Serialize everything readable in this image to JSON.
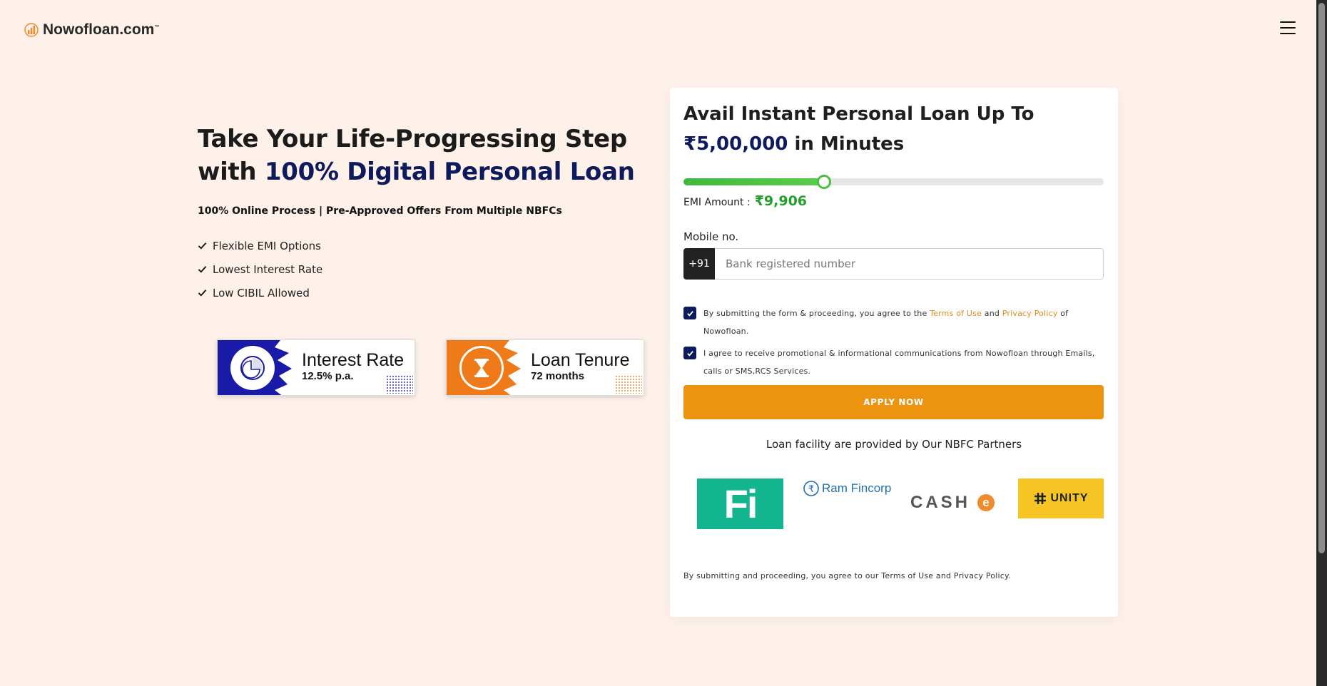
{
  "header": {
    "logo_text": "Nowofloan.com",
    "logo_tm": "™"
  },
  "hero": {
    "title_part1": "Take Your Life-Progressing Step with ",
    "title_highlight": "100% Digital Personal Loan",
    "subtitle": "100% Online Process | Pre-Approved Offers From Multiple NBFCs",
    "features": [
      "Flexible EMI Options",
      "Lowest Interest Rate",
      "Low CIBIL Allowed"
    ]
  },
  "badges": [
    {
      "title": "Interest Rate",
      "value": "12.5% p.a.",
      "color": "#1a1aa8",
      "icon": "pie-chart-icon"
    },
    {
      "title": "Loan Tenure",
      "value": "72 months",
      "color": "#ef7a1a",
      "icon": "hourglass-icon"
    }
  ],
  "form": {
    "title_part1": "Avail Instant Personal Loan Up To ",
    "title_amount": "₹5,00,000",
    "title_part2": " in Minutes",
    "slider_fraction": 0.335,
    "emi_label": "EMI Amount :",
    "emi_value": "₹9,906",
    "mobile_label": "Mobile no.",
    "country_code": "+91",
    "mobile_placeholder": "Bank registered number",
    "consent1_prefix": "By submitting the form & proceeding, you agree to the ",
    "consent1_terms": "Terms of Use",
    "consent1_and": " and ",
    "consent1_privacy": "Privacy Policy",
    "consent1_suffix": " of Nowofloan.",
    "consent2": "I agree to receive promotional & informational communications from Nowofloan through Emails, calls or SMS,RCS Services.",
    "apply_label": "APPLY NOW",
    "partners_title": "Loan facility are provided by Our NBFC Partners",
    "partners": {
      "fi": "Fi",
      "ram": "Ram Fincorp",
      "cashe_text": "CASH",
      "cashe_e": "e",
      "unity": "UNITY"
    },
    "footer_note": "By submitting and proceeding, you agree to our Terms of Use and Privacy Policy."
  },
  "colors": {
    "background": "#fdf1ea",
    "navy": "#0d1a5c",
    "orange": "#ec9410",
    "green": "#23a02c"
  }
}
